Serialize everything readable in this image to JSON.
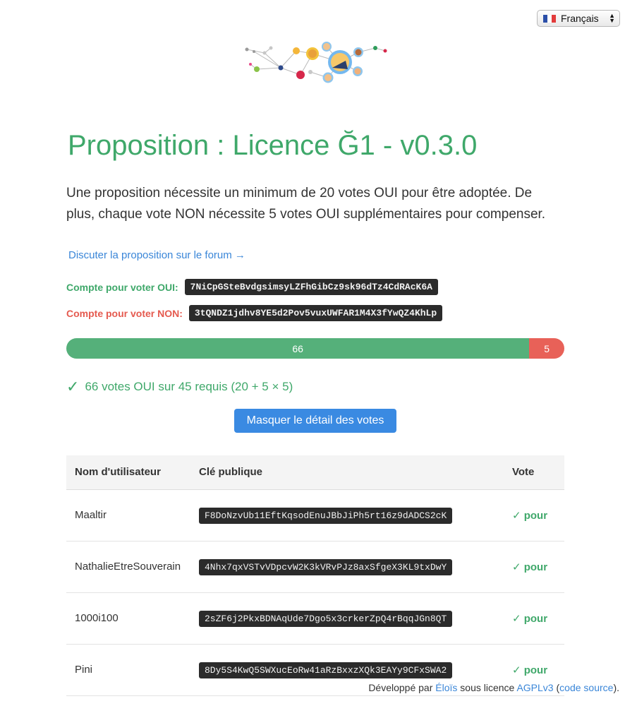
{
  "language": {
    "selected": "Français"
  },
  "title": "Proposition : Licence Ğ1 - v0.3.0",
  "intro": "Une proposition nécessite un minimum de 20 votes OUI pour être adoptée. De plus, chaque vote NON nécessite 5 votes OUI supplémentaires pour compenser.",
  "forum_link": "Discuter la proposition sur le forum →",
  "accounts": {
    "yes_label": "Compte pour voter OUI:",
    "yes_key": "7NiCpGSteBvdgsimsyLZFhGibCz9sk96dTz4CdRAcK6A",
    "no_label": "Compte pour voter NON:",
    "no_key": "3tQNDZ1jdhv8YE5d2Pov5vuxUWFAR1M4X3fYwQZ4KhLp"
  },
  "progress": {
    "yes": 66,
    "no": 5,
    "yes_label": "66",
    "no_label": "5"
  },
  "result_text": "66 votes OUI sur 45 requis (20 + 5 × 5)",
  "toggle_button": "Masquer le détail des votes",
  "table": {
    "headers": [
      "Nom d'utilisateur",
      "Clé publique",
      "Vote"
    ],
    "rows": [
      {
        "user": "Maaltir",
        "key": "F8DoNzvUb11EftKqsodEnuJBbJiPh5rt16z9dADCS2cK",
        "vote": "✓ pour"
      },
      {
        "user": "NathalieEtreSouverain",
        "key": "4Nhx7qxVSTvVDpcvW2K3kVRvPJz8axSfgeX3KL9txDwY",
        "vote": "✓ pour"
      },
      {
        "user": "1000i100",
        "key": "2sZF6j2PkxBDNAqUde7Dgo5x3crkerZpQ4rBqqJGn8QT",
        "vote": "✓ pour"
      },
      {
        "user": "Pini",
        "key": "8Dy5S4KwQ5SWXucEoRw41aRzBxxzXQk3EAYy9CFxSWA2",
        "vote": "✓ pour"
      }
    ]
  },
  "footer": {
    "prefix": "Développé par",
    "author": "Éloïs",
    "middle": "sous licence",
    "license": "AGPLv3",
    "open_paren": "(",
    "source": "code source",
    "close": ")."
  },
  "colors": {
    "accent_green": "#3fa86a",
    "no_red": "#e55a4f",
    "link_blue": "#3a86d8",
    "button_blue": "#3a8ae2"
  }
}
